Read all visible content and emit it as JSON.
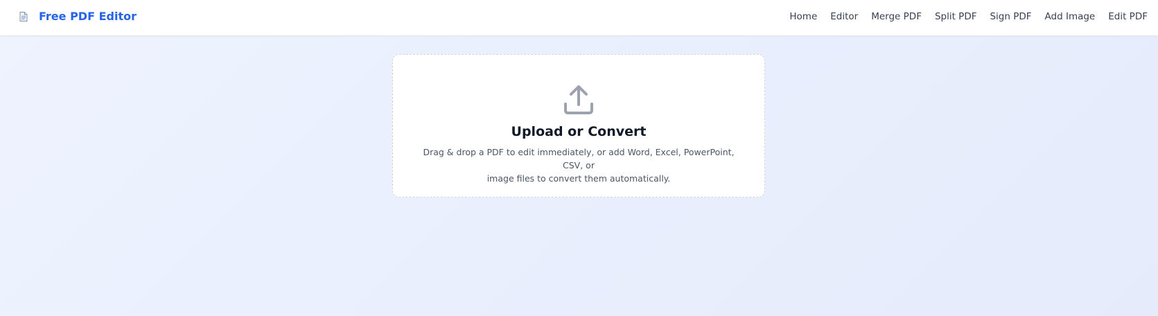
{
  "header": {
    "brand_icon": "document-icon",
    "brand_title": "Free PDF Editor",
    "brand_color": "#2563eb",
    "nav": [
      {
        "label": "Home"
      },
      {
        "label": "Editor"
      },
      {
        "label": "Merge PDF"
      },
      {
        "label": "Split PDF"
      },
      {
        "label": "Sign PDF"
      },
      {
        "label": "Add Image"
      },
      {
        "label": "Edit PDF"
      }
    ]
  },
  "upload": {
    "icon": "upload-icon",
    "title": "Upload or Convert",
    "description_line1": "Drag & drop a PDF to edit immediately, or add Word, Excel, PowerPoint, CSV, or",
    "description_line2": "image files to convert them automatically."
  }
}
